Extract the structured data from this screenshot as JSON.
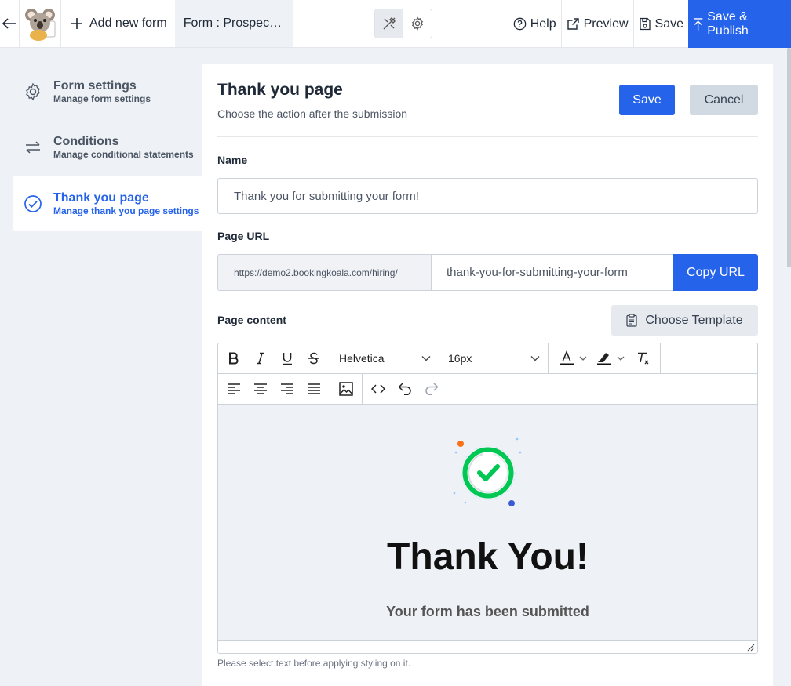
{
  "topbar": {
    "add_label": "Add new form",
    "form_title": "Form : Prospecti...",
    "help": "Help",
    "preview": "Preview",
    "save": "Save",
    "publish": "Save & Publish"
  },
  "sidebar": {
    "items": [
      {
        "title": "Form settings",
        "subtitle": "Manage form settings",
        "icon": "gear-icon"
      },
      {
        "title": "Conditions",
        "subtitle": "Manage conditional statements",
        "icon": "arrows-icon"
      },
      {
        "title": "Thank you page",
        "subtitle": "Manage thank you page settings",
        "icon": "check-circle-icon"
      }
    ]
  },
  "panel": {
    "title": "Thank you page",
    "subtitle": "Choose the action after the submission",
    "save": "Save",
    "cancel": "Cancel",
    "name_label": "Name",
    "name_value": "Thank you for submitting your form!",
    "url_label": "Page URL",
    "url_prefix": "https://demo2.bookingkoala.com/hiring/",
    "url_slug": "thank-you-for-submitting-your-form",
    "copy_url": "Copy URL",
    "content_label": "Page content",
    "choose_template": "Choose Template",
    "hint": "Please select text before applying styling on it."
  },
  "editor": {
    "font": "Helvetica",
    "size": "16px",
    "heading": "Thank You!",
    "subheading": "Your form has been submitted"
  },
  "colors": {
    "accent": "#2563eb",
    "success": "#00c853"
  }
}
